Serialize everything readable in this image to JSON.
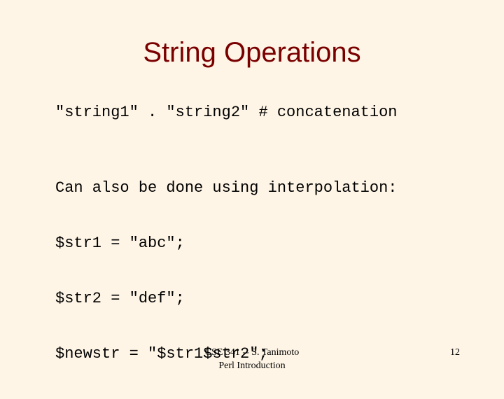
{
  "slide": {
    "title": "String Operations",
    "title_color": "#7a0000",
    "background_color": "#fef5e6",
    "concat_line": "\"string1\" . \"string2\" # concatenation",
    "interpolation_lines": [
      "Can also be done using interpolation:",
      "$str1 = \"abc\";",
      "$str2 = \"def\";",
      "$newstr = \"$str1$str2\";"
    ],
    "footer": {
      "line1": "CSE 341 -- S. Tanimoto",
      "line2": "Perl Introduction",
      "page_number": "12"
    }
  }
}
